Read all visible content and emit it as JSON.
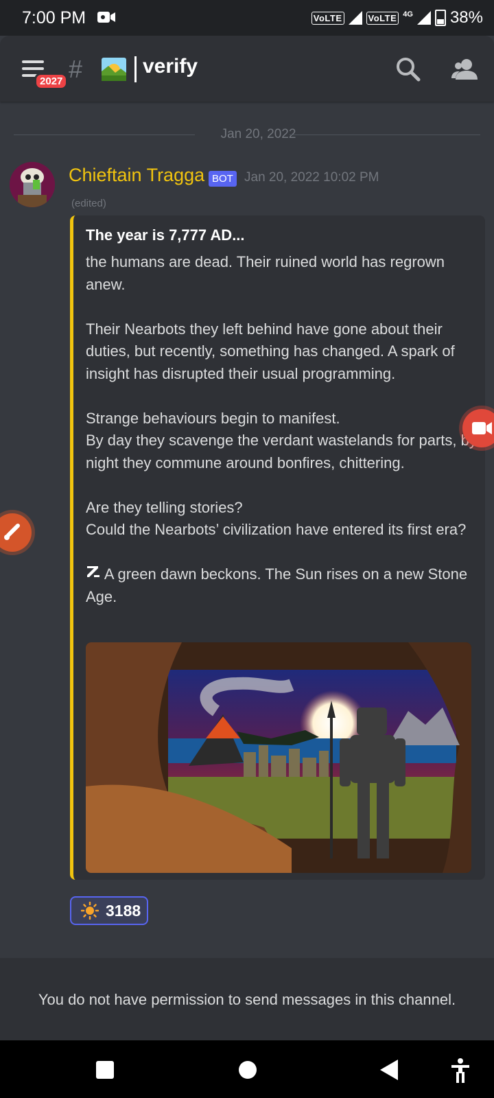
{
  "status_bar": {
    "time": "7:00 PM",
    "volte1": "VoLTE",
    "volte2": "VoLTE",
    "network": "4G",
    "battery": "38%"
  },
  "header": {
    "badge_count": "2027",
    "hash_symbol": "#",
    "channel_emoji": "sunrise-over-mountains-icon",
    "channel_name": "verify"
  },
  "date_divider": "Jan 20, 2022",
  "message": {
    "author": "Chieftain Tragga",
    "bot_tag": "BOT",
    "timestamp": "Jan 20, 2022 10:02 PM",
    "edited": "(edited)",
    "embed": {
      "accent_color": "#f1c40f",
      "title": "The year is 7,777 AD...",
      "description": "the humans are dead. Their ruined world has regrown anew.\n\nTheir Nearbots they left behind have gone about their duties, but recently, something has changed. A spark of insight has disrupted their usual programming.\n\nStrange behaviours begin to manifest.\nBy day they scavenge the verdant wastelands for parts, by night they commune around bonfires, chittering.\n\nAre they telling stories?\nCould the Nearbots’ civilization have entered its first era?",
      "final_line": "A green dawn beckons. The Sun rises on a new Stone Age."
    },
    "reaction": {
      "emoji": "sun-icon",
      "count": "3188"
    }
  },
  "permission_notice": "You do not have permission to send messages in this channel."
}
